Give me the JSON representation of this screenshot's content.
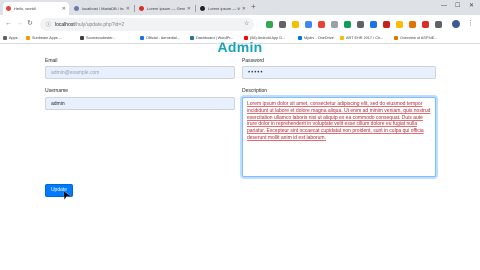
{
  "tabs": [
    {
      "title": "Hello, world!",
      "fav_color": "#ea4335"
    },
    {
      "title": "localhost / MariaDB / huly / user...",
      "fav_color": "#6c78af"
    },
    {
      "title": "Lorem Ipsum — Generator - Lipsum",
      "fav_color": "#d93025"
    },
    {
      "title": "Lorem ipsum — Wikipedia, Origin...",
      "fav_color": "#202124"
    }
  ],
  "address_bar": {
    "host": "localhost",
    "path": "/huly/update.php?id=2"
  },
  "bookmarks": [
    "Apps",
    "Sunbeam Apps ...",
    "Sourcecodester...",
    "Official - Aeroedial...",
    "Dashboard | WordPr...",
    "(58) Android App D...",
    "Mydrv - OneDrive",
    "ART EHR 2017 / Ch...",
    "Overview of ASP.NE..."
  ],
  "page": {
    "title": "Admin",
    "email_label": "Email",
    "email_placeholder": "admin@example.com",
    "password_label": "Password",
    "password_value": "•••••",
    "username_label": "Username",
    "username_value": "admin",
    "description_label": "Description",
    "description_text": "Lorem ipsum dolor sit amet, consectetur adipiscing elit, sed do eiusmod tempor incididunt ut labore et dolore magna aliqua. Ut enim ad minim veniam, quis nostrud exercitation ullamco laboris nisi ut aliquip ex ea commodo consequat. Duis aute irure dolor in reprehenderit in voluptate velit esse cillum dolore eu fugiat nulla pariatur. Excepteur sint occaecat cupidatat non proident, sunt in culpa qui officia deserunt mollit anim id est laborum.",
    "update_label": "Update"
  },
  "colors": {
    "accent": "#17a2b8",
    "primary": "#007bff",
    "autofill": "#e8f0fe"
  },
  "icons": [
    "back-arrow-icon",
    "forward-arrow-icon",
    "reload-icon",
    "lock-icon",
    "star-icon",
    "profile-avatar-icon",
    "menu-icon",
    "mouse-cursor-icon"
  ]
}
